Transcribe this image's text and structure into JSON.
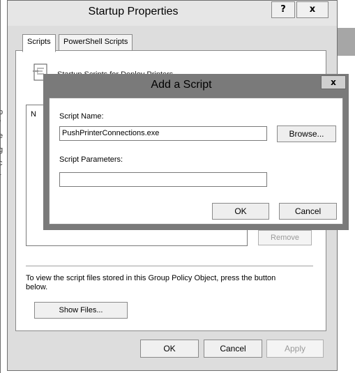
{
  "window": {
    "title": "Startup Properties",
    "help_button": "?",
    "close_button": "x",
    "tabs": [
      {
        "label": "Scripts"
      },
      {
        "label": "PowerShell Scripts"
      }
    ],
    "panel": {
      "heading_partial": "Startup Scripts for Deploy Printers",
      "list_column_label": "N",
      "remove_button": "Remove",
      "help_text": "To view the script files stored in this Group Policy Object, press the button below.",
      "show_files_button": "Show Files..."
    },
    "footer": {
      "ok": "OK",
      "cancel": "Cancel",
      "apply": "Apply"
    }
  },
  "dialog": {
    "title": "Add a Script",
    "close_button": "x",
    "script_name_label": "Script Name:",
    "script_name_value": "PushPrinterConnections.exe",
    "browse_button": "Browse...",
    "script_params_label": "Script Parameters:",
    "script_params_value": "",
    "ok_button": "OK",
    "cancel_button": "Cancel"
  },
  "background": {
    "edge_chars": [
      "p",
      "/",
      "e",
      "g",
      "c",
      "r"
    ]
  }
}
